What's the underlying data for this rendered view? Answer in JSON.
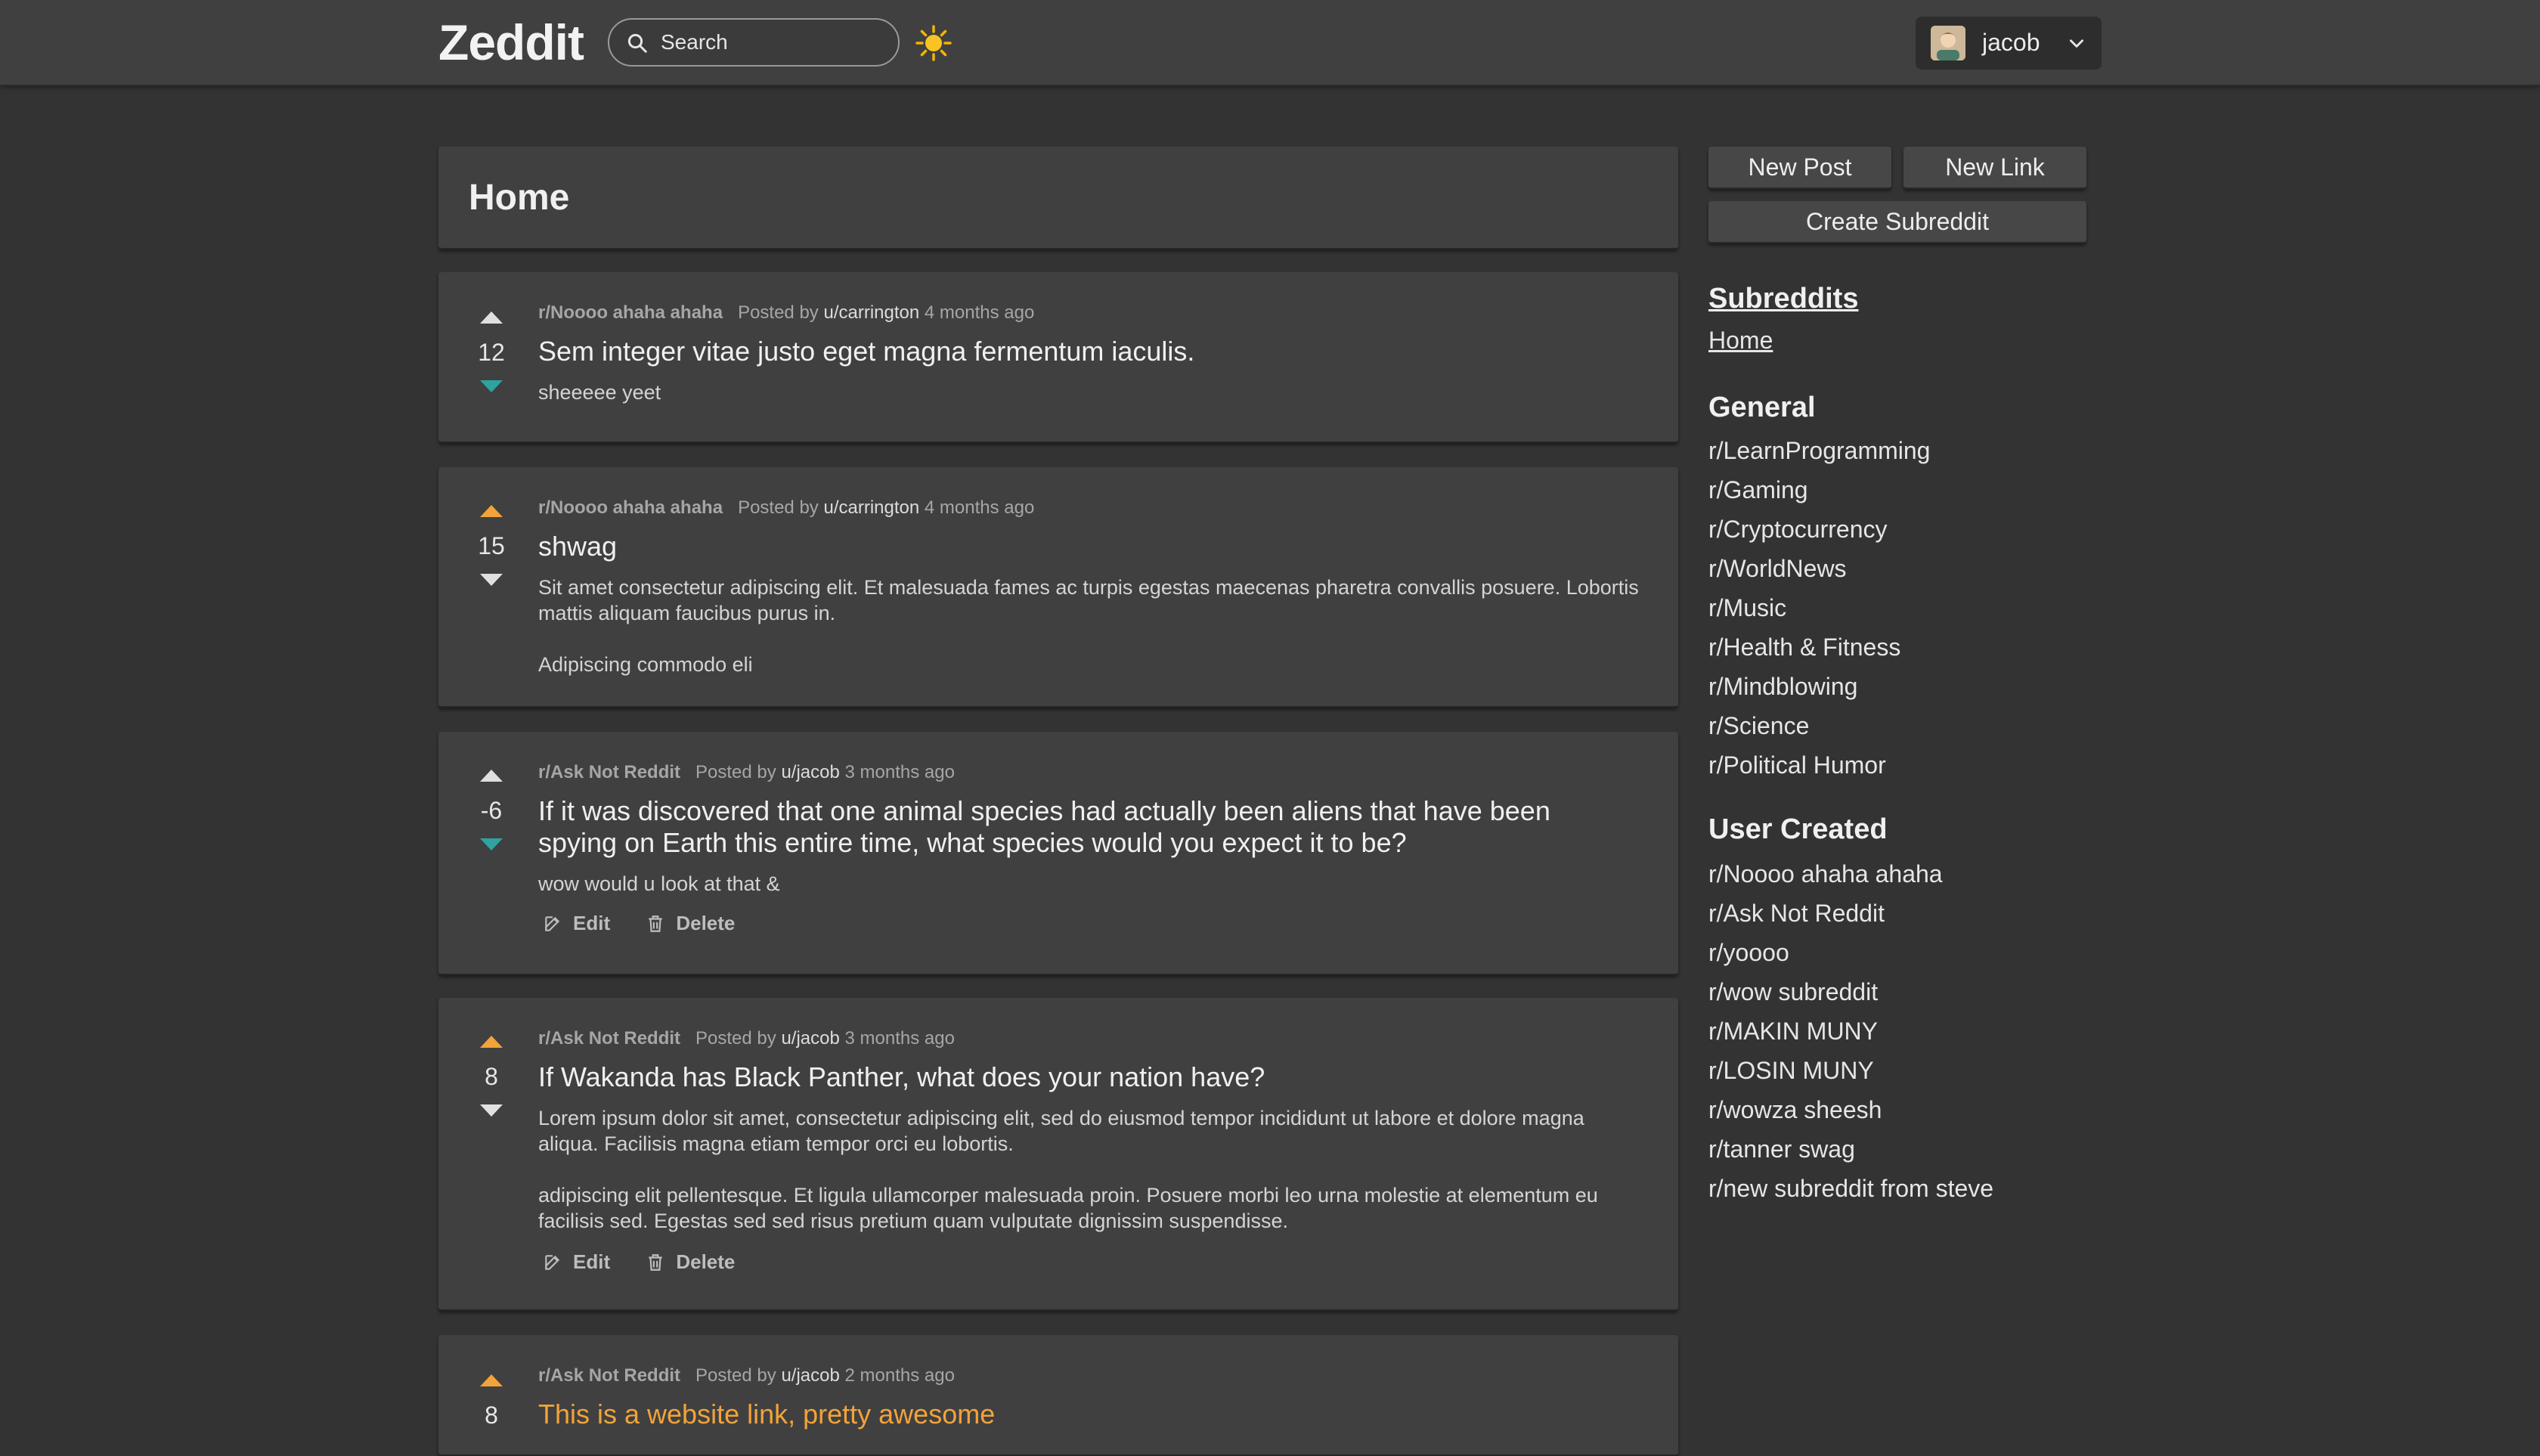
{
  "navbar": {
    "brand": "Zeddit",
    "search_placeholder": "Search",
    "theme_icon": "sun-icon",
    "username": "jacob"
  },
  "feed": {
    "heading": "Home",
    "posts": [
      {
        "subreddit": "r/Noooo ahaha ahaha",
        "posted_by": "Posted by",
        "author": "u/carrington",
        "time": "4 months ago",
        "score": "12",
        "vote": "down",
        "title": "Sem integer vitae justo eget magna fermentum iaculis.",
        "body1": "sheeeee yeet",
        "body2": ""
      },
      {
        "subreddit": "r/Noooo ahaha ahaha",
        "posted_by": "Posted by",
        "author": "u/carrington",
        "time": "4 months ago",
        "score": "15",
        "vote": "up",
        "title": "shwag",
        "body1": "Sit amet consectetur adipiscing elit. Et malesuada fames ac turpis egestas maecenas pharetra convallis posuere. Lobortis mattis aliquam faucibus purus in.",
        "body2": "Adipiscing commodo eli"
      },
      {
        "subreddit": "r/Ask Not Reddit",
        "posted_by": "Posted by",
        "author": "u/jacob",
        "time": "3 months ago",
        "score": "-6",
        "vote": "down",
        "title": "If it was discovered that one animal species had actually been aliens that have been spying on Earth this entire time, what species would you expect it to be?",
        "body1": "wow would u look at that &",
        "body2": "",
        "edit_label": "Edit",
        "delete_label": "Delete"
      },
      {
        "subreddit": "r/Ask Not Reddit",
        "posted_by": "Posted by",
        "author": "u/jacob",
        "time": "3 months ago",
        "score": "8",
        "vote": "up",
        "title": "If Wakanda has Black Panther, what does your nation have?",
        "body1": "Lorem ipsum dolor sit amet, consectetur adipiscing elit, sed do eiusmod tempor incididunt ut labore et dolore magna aliqua. Facilisis magna etiam tempor orci eu lobortis.",
        "body2": " adipiscing elit pellentesque. Et ligula ullamcorper malesuada proin. Posuere morbi leo urna molestie at elementum eu facilisis sed. Egestas sed sed risus pretium quam vulputate dignissim suspendisse.",
        "edit_label": "Edit",
        "delete_label": "Delete"
      },
      {
        "subreddit": "r/Ask Not Reddit",
        "posted_by": "Posted by",
        "author": "u/jacob",
        "time": "2 months ago",
        "score": "8",
        "vote": "up",
        "title": "This is a website link, pretty awesome",
        "body1": "",
        "body2": ""
      }
    ]
  },
  "sidebar": {
    "new_post": "New Post",
    "new_link": "New Link",
    "create_subreddit": "Create Subreddit",
    "subreddits_heading": "Subreddits",
    "home_link": "Home",
    "general_heading": "General",
    "general": [
      "r/LearnProgramming",
      "r/Gaming",
      "r/Cryptocurrency",
      "r/WorldNews",
      "r/Music",
      "r/Health & Fitness",
      "r/Mindblowing",
      "r/Science",
      "r/Political Humor"
    ],
    "user_created_heading": "User Created",
    "user_created": [
      "r/Noooo ahaha ahaha",
      "r/Ask Not Reddit",
      "r/yoooo",
      "r/wow subreddit",
      "r/MAKIN MUNY",
      "r/LOSIN MUNY",
      "r/wowza sheesh",
      "r/tanner swag",
      "r/new subreddit from steve"
    ]
  },
  "colors": {
    "upvote_active": "#f2a33a",
    "downvote_active": "#2fa3a0",
    "vote_inactive": "#e0e0e0",
    "link_title": "#f2a33a"
  }
}
